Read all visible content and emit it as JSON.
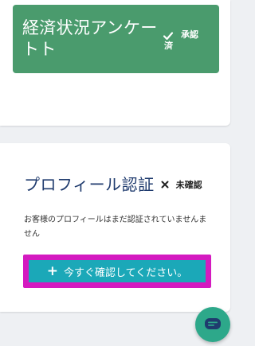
{
  "survey_card": {
    "title": "経済状況アンケート",
    "title_tail": "ト",
    "status_icon": "check-icon",
    "status_part_a": "済",
    "status_part_b": "承認",
    "color": "#4a9b6d"
  },
  "profile_card": {
    "title": "プロフィール認証",
    "status_icon": "close-icon",
    "status": "未確認",
    "description": "お客様のプロフィールはまだ認証されていませんません",
    "cta_label": "今すぐ確認してください。",
    "cta_icon": "plus-icon",
    "cta_color": "#1ba8b8",
    "highlight_color": "#d41ac0"
  },
  "chat": {
    "icon": "chat-icon",
    "color": "#2da88a"
  }
}
